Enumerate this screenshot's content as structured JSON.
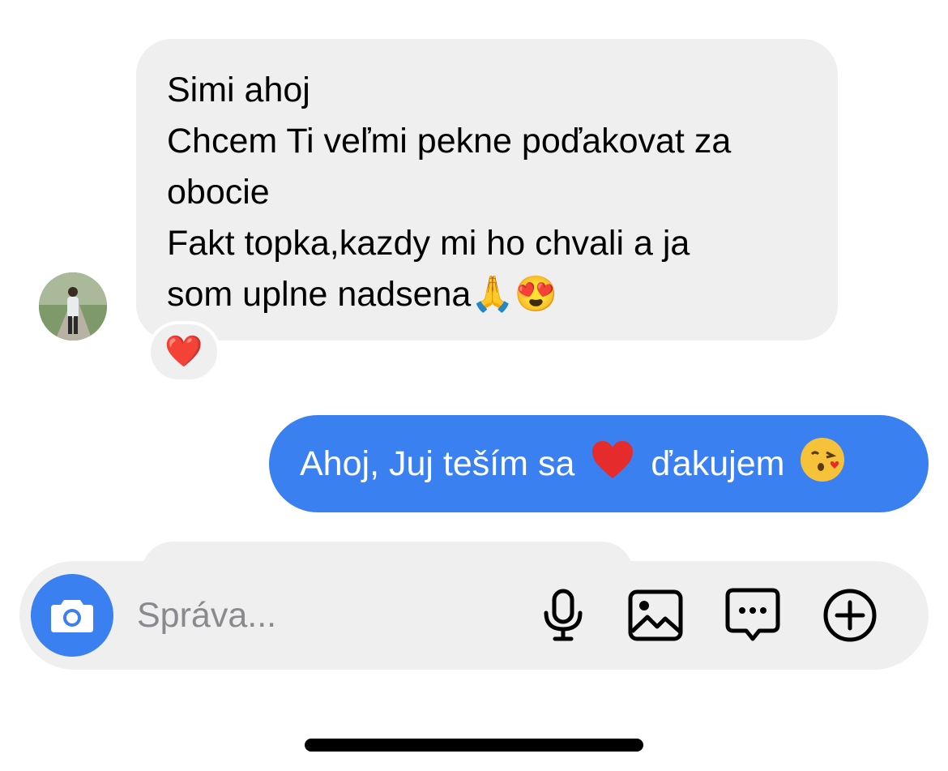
{
  "conversation": {
    "incoming_message": {
      "lines": [
        "Simi ahoj",
        "Chcem Ti veľmi pekne poďakovat za",
        "obocie",
        "Fakt topka,kazdy mi ho chvali a ja",
        "som uplne nadsena🙏😍"
      ],
      "reaction": "❤️"
    },
    "outgoing_message": {
      "text_before": "Ahoj, Juj teším sa",
      "text_after": "ďakujem",
      "emoji_heart": "red-heart-emoji",
      "emoji_kiss": "face-blowing-kiss-emoji"
    }
  },
  "composer": {
    "placeholder": "Správa...",
    "icons": [
      "camera-icon",
      "microphone-icon",
      "image-icon",
      "chat-bubble-icon",
      "plus-circle-icon"
    ],
    "accent_color": "#3a80f0"
  }
}
